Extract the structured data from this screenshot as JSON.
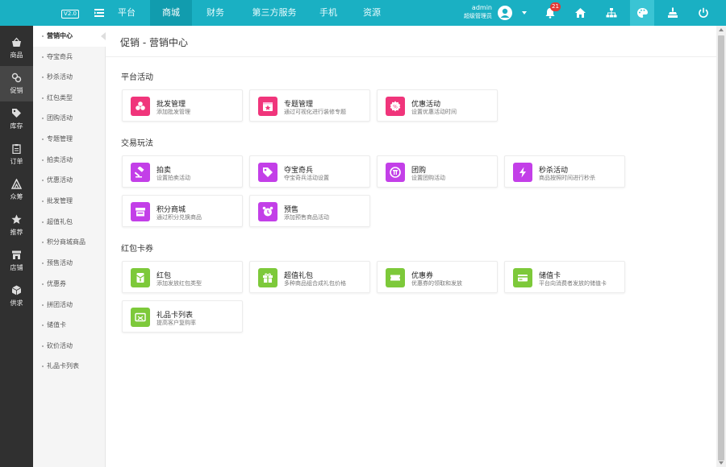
{
  "topbar": {
    "version": "V2.0",
    "tabs": [
      "平台",
      "商城",
      "财务",
      "第三方服务",
      "手机",
      "资源"
    ],
    "active_tab": "商城",
    "user_name": "admin",
    "user_role": "超级管理员",
    "notification_count": "21",
    "icons": [
      "bell-icon",
      "home-icon",
      "sitemap-icon",
      "palette-icon",
      "broom-icon",
      "power-icon"
    ],
    "accent": "#1ab0c3"
  },
  "sidebar": {
    "items": [
      {
        "label": "商品",
        "icon": "basket-icon"
      },
      {
        "label": "促销",
        "icon": "link-icon"
      },
      {
        "label": "库存",
        "icon": "tag-icon"
      },
      {
        "label": "订单",
        "icon": "clipboard-icon"
      },
      {
        "label": "众筹",
        "icon": "triangle-icon"
      },
      {
        "label": "推荐",
        "icon": "star-icon"
      },
      {
        "label": "店铺",
        "icon": "store-icon"
      },
      {
        "label": "供求",
        "icon": "cube-icon"
      }
    ],
    "active": "促销"
  },
  "submenu": {
    "items": [
      "营销中心",
      "夺宝奇兵",
      "秒杀活动",
      "红包类型",
      "团购活动",
      "专题管理",
      "拍卖活动",
      "优惠活动",
      "批发管理",
      "超值礼包",
      "积分商城商品",
      "预售活动",
      "优惠券",
      "拼团活动",
      "储值卡",
      "砍价活动",
      "礼品卡列表"
    ],
    "active": "营销中心"
  },
  "main": {
    "page_title": "促销 - 营销中心",
    "sections": [
      {
        "title": "平台活动",
        "cards": [
          {
            "title": "批发管理",
            "desc": "添加批发管理",
            "color": "#f0357b",
            "icon": "clover-icon"
          },
          {
            "title": "专题管理",
            "desc": "通过可视化进行装修专题",
            "color": "#f0357b",
            "icon": "star-box-icon"
          },
          {
            "title": "优惠活动",
            "desc": "设置优惠活动时间",
            "color": "#f0357b",
            "icon": "gear-badge-icon"
          }
        ]
      },
      {
        "title": "交易玩法",
        "cards": [
          {
            "title": "拍卖",
            "desc": "设置拍卖活动",
            "color": "#c33fe8",
            "icon": "gavel-icon"
          },
          {
            "title": "夺宝奇兵",
            "desc": "夺宝奇兵活动设置",
            "color": "#c33fe8",
            "icon": "tag-icon"
          },
          {
            "title": "团购",
            "desc": "设置团购活动",
            "color": "#c33fe8",
            "icon": "group-icon"
          },
          {
            "title": "秒杀活动",
            "desc": "商品按照时间进行秒杀",
            "color": "#c33fe8",
            "icon": "lightning-icon"
          },
          {
            "title": "积分商城",
            "desc": "通过积分兑换商品",
            "color": "#c33fe8",
            "icon": "shop-icon"
          },
          {
            "title": "预售",
            "desc": "添加预售商品活动",
            "color": "#c33fe8",
            "icon": "alarm-icon"
          }
        ]
      },
      {
        "title": "红包卡券",
        "cards": [
          {
            "title": "红包",
            "desc": "添加发放红包类型",
            "color": "#7dc93a",
            "icon": "envelope-icon"
          },
          {
            "title": "超值礼包",
            "desc": "多种商品组合成礼包价格",
            "color": "#7dc93a",
            "icon": "gift-icon"
          },
          {
            "title": "优惠券",
            "desc": "优惠券的领取和发放",
            "color": "#7dc93a",
            "icon": "ticket-icon"
          },
          {
            "title": "储值卡",
            "desc": "平台向消费者发放的储值卡",
            "color": "#7dc93a",
            "icon": "card-icon"
          },
          {
            "title": "礼品卡列表",
            "desc": "提高客户复购率",
            "color": "#7dc93a",
            "icon": "giftcard-icon"
          }
        ]
      }
    ]
  }
}
